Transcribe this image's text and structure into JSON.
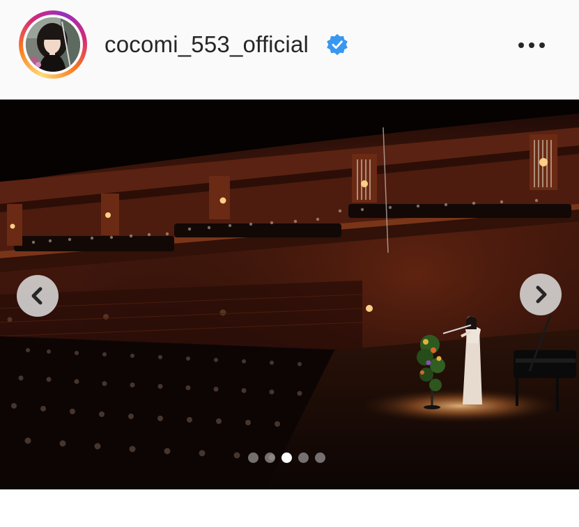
{
  "header": {
    "username": "cocomi_553_official",
    "verified": true,
    "avatar_icon": "profile-photo",
    "more_icon": "more-horizontal-icon"
  },
  "carousel": {
    "slide_count": 5,
    "active_index": 2,
    "prev_icon": "chevron-left-icon",
    "next_icon": "chevron-right-icon"
  },
  "colors": {
    "verified_blue": "#3897f0",
    "header_bg": "#fafafa",
    "ring_gradient": [
      "#feda75",
      "#fa7e1e",
      "#d62976",
      "#962fbf"
    ]
  }
}
